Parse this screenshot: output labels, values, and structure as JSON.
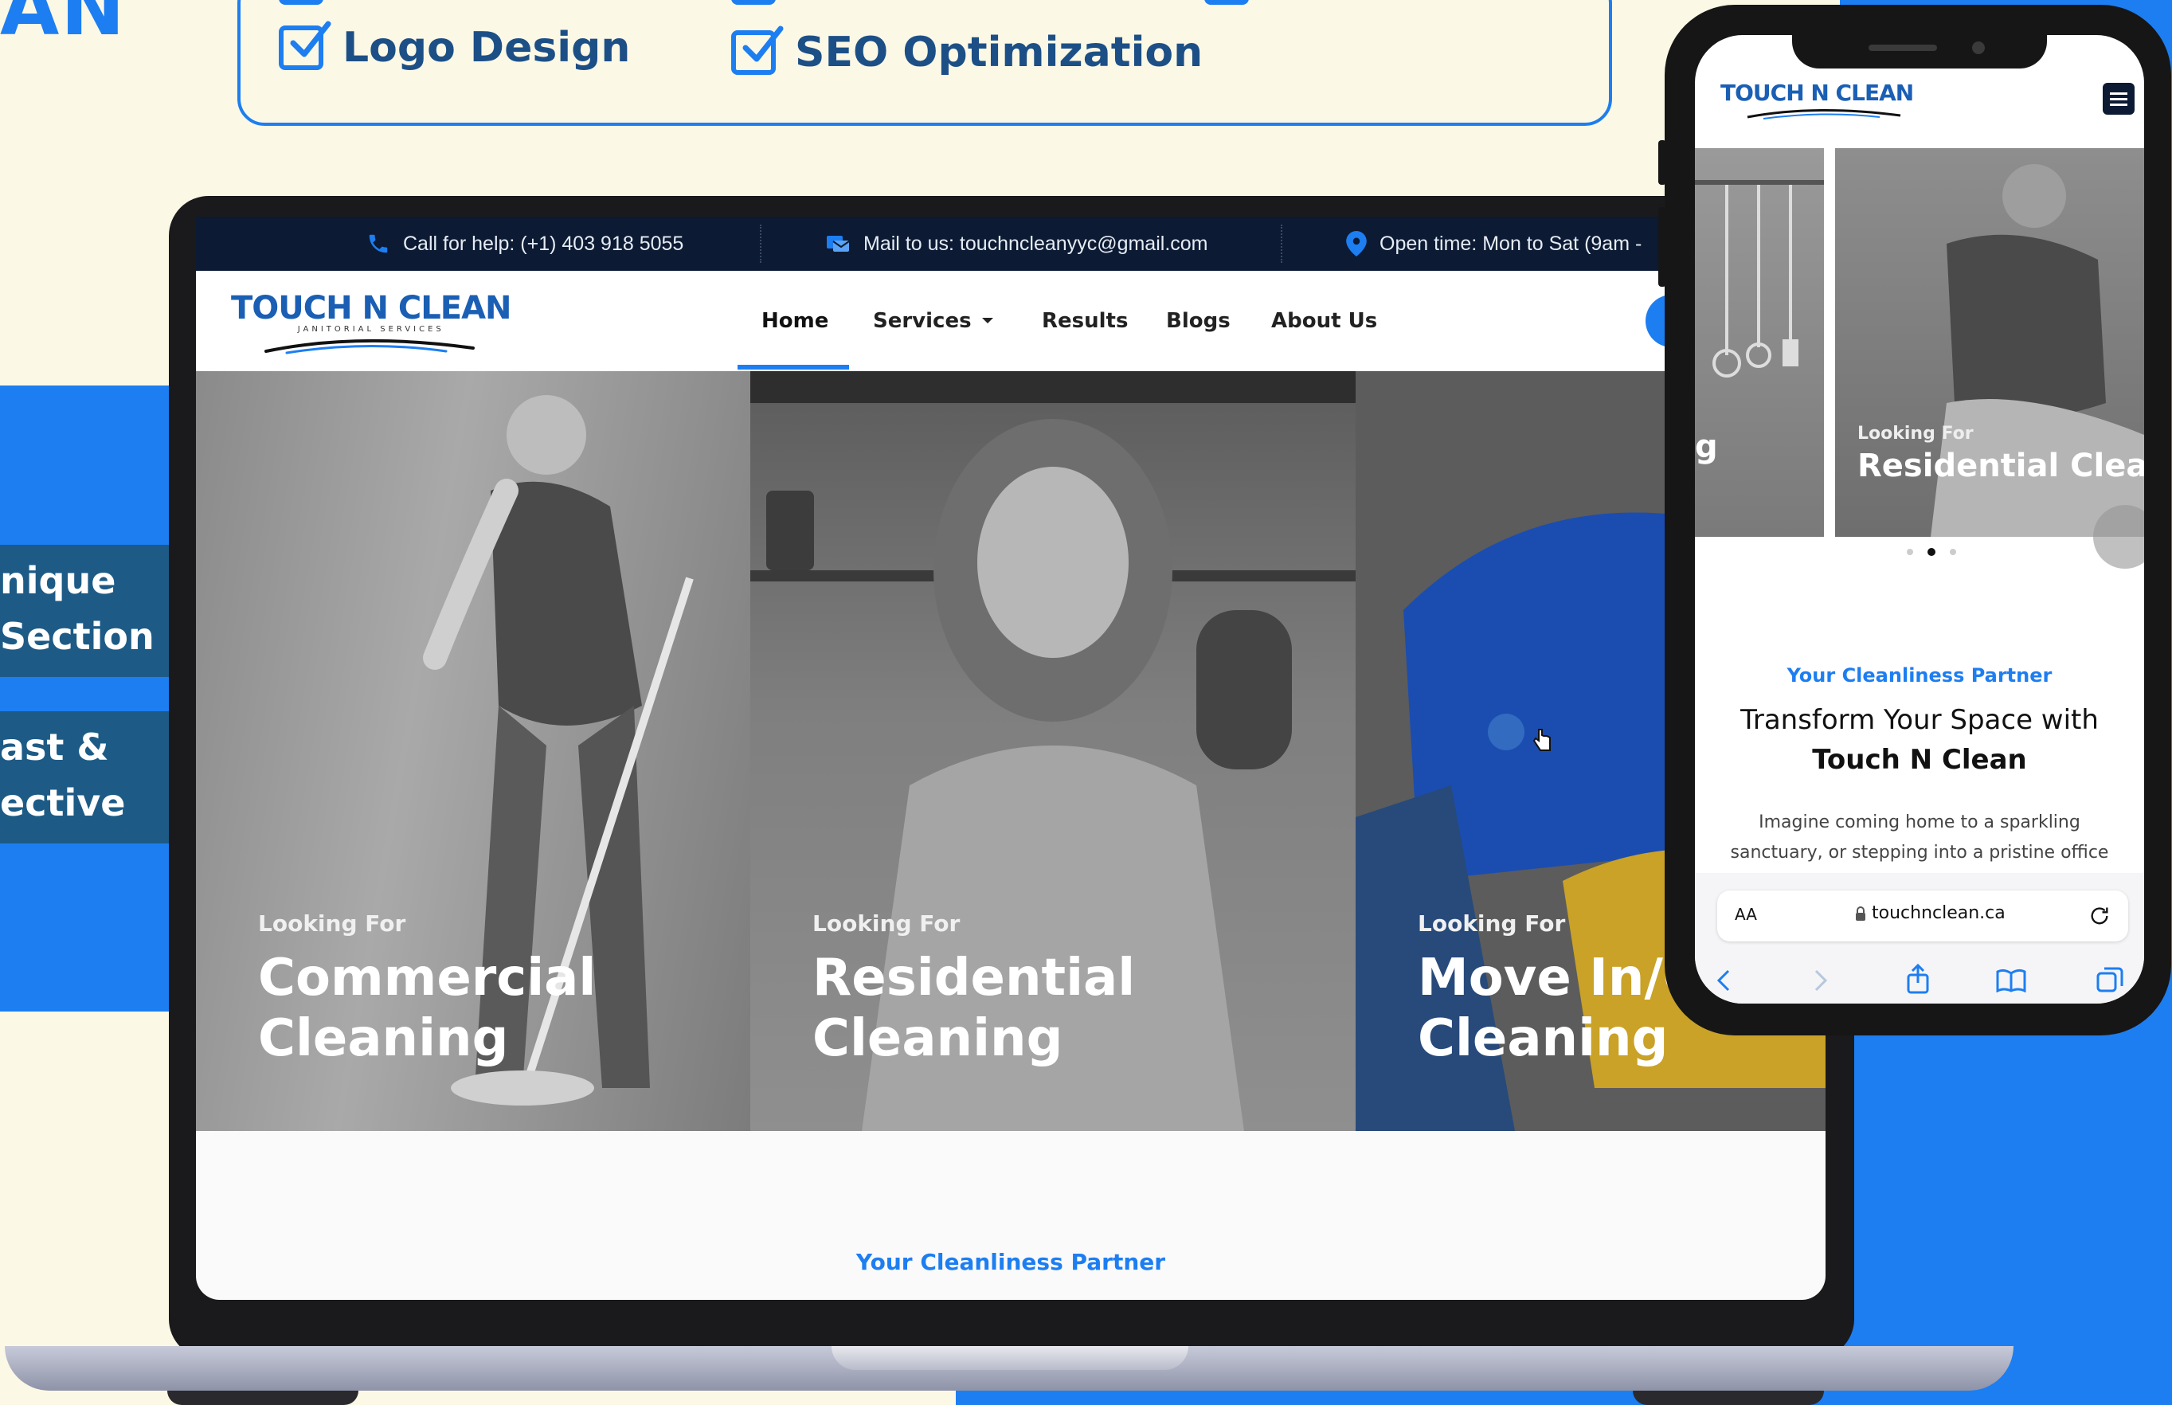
{
  "background": {
    "brand_fragment": "AN",
    "side_cards": [
      {
        "line1": "nique",
        "line2": " Section"
      },
      {
        "line1": "ast &",
        "line2": "ective"
      }
    ]
  },
  "features": {
    "row1": [],
    "row2": [
      "Logo Design",
      "SEO Optimization"
    ]
  },
  "site": {
    "topbar": {
      "call": "Call for help: (+1) 403 918 5055",
      "mail": "Mail to us: touchncleanyyc@gmail.com",
      "open": "Open time: Mon to Sat (9am - "
    },
    "logo": {
      "name": "TOUCH N CLEAN",
      "tagline": "JANITORIAL SERVICES"
    },
    "nav": [
      "Home",
      "Services",
      "Results",
      "Blogs",
      "About Us"
    ],
    "panels": [
      {
        "label": "Looking For",
        "title": "Commercial\nCleaning"
      },
      {
        "label": "Looking For",
        "title": "Residential\nCleaning"
      },
      {
        "label": "Looking For",
        "title": "Move In/C\nCleaning"
      }
    ],
    "partner_label": "Your Cleanliness Partner"
  },
  "phone": {
    "logo": "TOUCH N CLEAN",
    "slide_fragment": "g",
    "slide_label": "Looking For",
    "slide_title": "Residential Clea",
    "partner_label": "Your Cleanliness Partner",
    "heading_line1": "Transform Your Space with",
    "heading_line2": "Touch N Clean",
    "body_line1": "Imagine coming home to a sparkling",
    "body_line2": "sanctuary, or stepping into a pristine office",
    "text_size": "AA",
    "url": "touchnclean.ca"
  },
  "colors": {
    "accent": "#1d7ef1",
    "navy": "#0c1a33",
    "background": "#fbf8e6",
    "card": "#1d5b86"
  }
}
